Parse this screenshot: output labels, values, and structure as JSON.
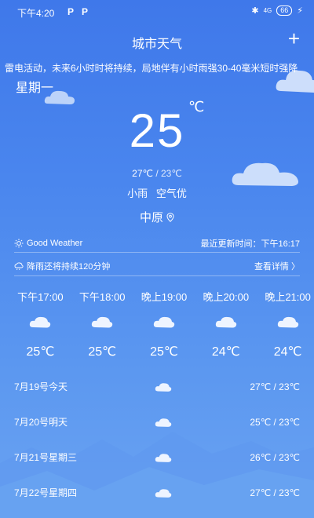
{
  "status_bar": {
    "time": "下午4:20",
    "left_icons": [
      "P",
      "P"
    ],
    "bluetooth": "✱",
    "signal": "4G",
    "battery": "66",
    "charging": "⚡"
  },
  "header": {
    "title": "城市天气",
    "add_label": "+"
  },
  "alert_ticker": "雷电活动，未来6小时时将持续，局地伴有小时雨强30-40毫米短时强降",
  "weekday": "星期一",
  "current": {
    "temperature": "25",
    "unit": "℃",
    "high": "27℃",
    "low_part": " / 23℃",
    "condition": "小雨",
    "air": "空气优",
    "location": "中原"
  },
  "info_row_1": {
    "good_weather": "Good Weather",
    "update_label": "最近更新时间：下午16:17"
  },
  "info_row_2": {
    "rain_text": "降雨还将持续120分钟",
    "detail_link": "查看详情 〉"
  },
  "hourly": [
    {
      "time": "下午17:00",
      "temp": "25℃",
      "icon": "cloud-icon"
    },
    {
      "time": "下午18:00",
      "temp": "25℃",
      "icon": "cloud-icon"
    },
    {
      "time": "晚上19:00",
      "temp": "25℃",
      "icon": "cloud-icon"
    },
    {
      "time": "晚上20:00",
      "temp": "24℃",
      "icon": "cloud-icon"
    },
    {
      "time": "晚上21:00",
      "temp": "24℃",
      "icon": "cloud-icon"
    }
  ],
  "daily": [
    {
      "label": "7月19号今天",
      "temp": "27℃ / 23℃"
    },
    {
      "label": "7月20号明天",
      "temp": "25℃ / 23℃"
    },
    {
      "label": "7月21号星期三",
      "temp": "26℃ / 23℃"
    },
    {
      "label": "7月22号星期四",
      "temp": "27℃ / 23℃"
    }
  ],
  "colors": {
    "background_top": "#3f78ea",
    "background_bottom": "#6aa3f2",
    "text": "#ffffff"
  }
}
